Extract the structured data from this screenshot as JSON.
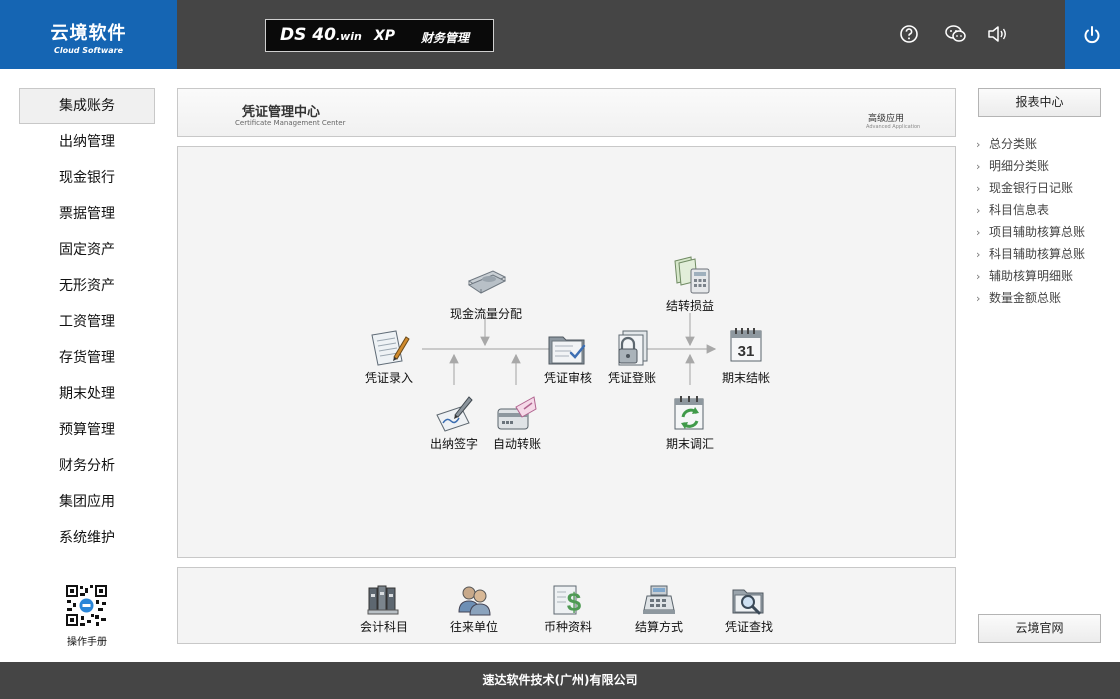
{
  "header": {
    "logo_cn": "云境软件",
    "logo_en": "Cloud Software",
    "product_ds": "DS 40",
    "product_win": ".win",
    "product_xp": "XP",
    "product_name": "财务管理",
    "icons": [
      "help-icon",
      "wechat-icon",
      "volume-icon",
      "power-icon"
    ],
    "colors": {
      "brand_blue": "#1565b3",
      "bar_dark": "#454545"
    }
  },
  "leftnav": {
    "items": [
      {
        "label": "集成账务",
        "active": true
      },
      {
        "label": "出纳管理"
      },
      {
        "label": "现金银行"
      },
      {
        "label": "票据管理"
      },
      {
        "label": "固定资产"
      },
      {
        "label": "无形资产"
      },
      {
        "label": "工资管理"
      },
      {
        "label": "存货管理"
      },
      {
        "label": "期末处理"
      },
      {
        "label": "预算管理"
      },
      {
        "label": "财务分析"
      },
      {
        "label": "集团应用"
      },
      {
        "label": "系统维护"
      }
    ],
    "manual_label": "操作手册"
  },
  "center": {
    "title": "凭证管理中心",
    "subtitle": "Certificate Management Center",
    "advanced": "高级应用",
    "advanced_en": "Advanced Application"
  },
  "flow": {
    "cashflow": "现金流量分配",
    "transfer_pl": "结转损益",
    "voucher_entry": "凭证录入",
    "voucher_audit": "凭证审核",
    "voucher_post": "凭证登账",
    "period_close": "期末结帐",
    "cashier_sign": "出纳签字",
    "auto_transfer": "自动转账",
    "period_adjust": "期末调汇",
    "calendar_day": "31"
  },
  "tools": [
    {
      "label": "会计科目",
      "icon": "ledger-binders-icon"
    },
    {
      "label": "往来单位",
      "icon": "contacts-icon"
    },
    {
      "label": "币种资料",
      "icon": "currency-icon"
    },
    {
      "label": "结算方式",
      "icon": "cash-register-icon"
    },
    {
      "label": "凭证查找",
      "icon": "search-folder-icon"
    }
  ],
  "right": {
    "report_center": "报表中心",
    "links": [
      "总分类账",
      "明细分类账",
      "现金银行日记账",
      "科目信息表",
      "项目辅助核算总账",
      "科目辅助核算总账",
      "辅助核算明细账",
      "数量金额总账"
    ],
    "website": "云境官网"
  },
  "footer": {
    "company": "速达软件技术(广州)有限公司"
  }
}
